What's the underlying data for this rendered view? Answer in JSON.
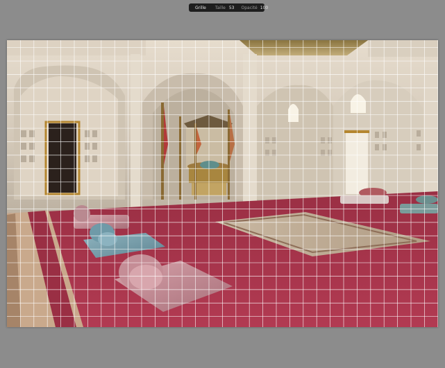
{
  "grid_toolbar": {
    "mode_label": "Grille",
    "size_label": "Taille",
    "size_value": "53",
    "opacity_label": "Opacité",
    "opacity_value": "100"
  },
  "grid_overlay": {
    "line_color": "#ffffff"
  },
  "colors": {
    "canvas_background": "#8c8c8c",
    "toolbar_background": "#1e1e1e",
    "carpet_red": "#a8344a"
  }
}
